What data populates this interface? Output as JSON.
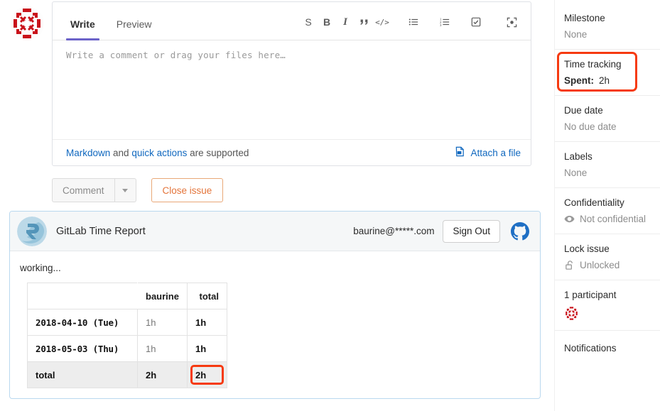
{
  "avatar": {
    "name": "user-identicon-avatar"
  },
  "note_form": {
    "tabs": [
      {
        "label": "Write",
        "active": true
      },
      {
        "label": "Preview",
        "active": false
      }
    ],
    "toolbar": [
      {
        "name": "strikethrough-icon",
        "label": "S"
      },
      {
        "name": "bold-icon",
        "label": "B"
      },
      {
        "name": "italic-icon",
        "label": "I"
      },
      {
        "name": "quote-icon",
        "label": "”"
      },
      {
        "name": "code-icon",
        "label": "</>"
      },
      {
        "name": "bullet-list-icon",
        "label": ""
      },
      {
        "name": "numbered-list-icon",
        "label": ""
      },
      {
        "name": "task-list-icon",
        "label": ""
      },
      {
        "name": "fullscreen-icon",
        "label": ""
      }
    ],
    "textarea_placeholder": "Write a comment or drag your files here…",
    "footer": {
      "markdown_link": "Markdown",
      "and_text": " and ",
      "quick_actions_link": "quick actions",
      "supported_text": " are supported",
      "attach_label": "Attach a file"
    }
  },
  "actions": {
    "comment_label": "Comment",
    "dropdown_name": "comment-dropdown-caret",
    "close_issue_label": "Close issue"
  },
  "report": {
    "logo_name": "gitlab-time-report-logo",
    "title": "GitLab Time Report",
    "email": "baurine@*****.com",
    "sign_out_label": "Sign Out",
    "github_icon_name": "github-icon",
    "status": "working...",
    "table": {
      "headers": [
        "",
        "baurine",
        "total"
      ],
      "rows": [
        {
          "date": "2018-04-10 (Tue)",
          "user": "1h",
          "total": "1h",
          "highlight": false
        },
        {
          "date": "2018-05-03 (Thu)",
          "user": "1h",
          "total": "1h",
          "highlight": false
        }
      ],
      "total_row": {
        "date": "total",
        "user": "2h",
        "total": "2h",
        "highlight": true
      }
    }
  },
  "sidebar": {
    "blocks": [
      {
        "title": "Milestone",
        "value": "None",
        "icon": null,
        "highlight": false,
        "bold_prefix": null
      },
      {
        "title": "Time tracking",
        "value": "2h",
        "icon": null,
        "highlight": true,
        "bold_prefix": "Spent:"
      },
      {
        "title": "Due date",
        "value": "No due date",
        "icon": null,
        "highlight": false,
        "bold_prefix": null
      },
      {
        "title": "Labels",
        "value": "None",
        "icon": null,
        "highlight": false,
        "bold_prefix": null
      },
      {
        "title": "Confidentiality",
        "value": "Not confidential",
        "icon": "eye-icon",
        "highlight": false,
        "bold_prefix": null
      },
      {
        "title": "Lock issue",
        "value": "Unlocked",
        "icon": "lock-open-icon",
        "highlight": false,
        "bold_prefix": null
      },
      {
        "title": "1 participant",
        "value": "",
        "icon": "participant-avatar",
        "highlight": false,
        "bold_prefix": null
      },
      {
        "title": "Notifications",
        "value": "",
        "icon": null,
        "highlight": false,
        "bold_prefix": null
      }
    ]
  },
  "colors": {
    "highlight_red": "#f63a10",
    "link_blue": "#1068bf",
    "tab_underline": "#6b63c9",
    "close_issue_orange": "#e4743a",
    "avatar_red": "#c9131b",
    "github_blue": "#1f6fc4"
  }
}
